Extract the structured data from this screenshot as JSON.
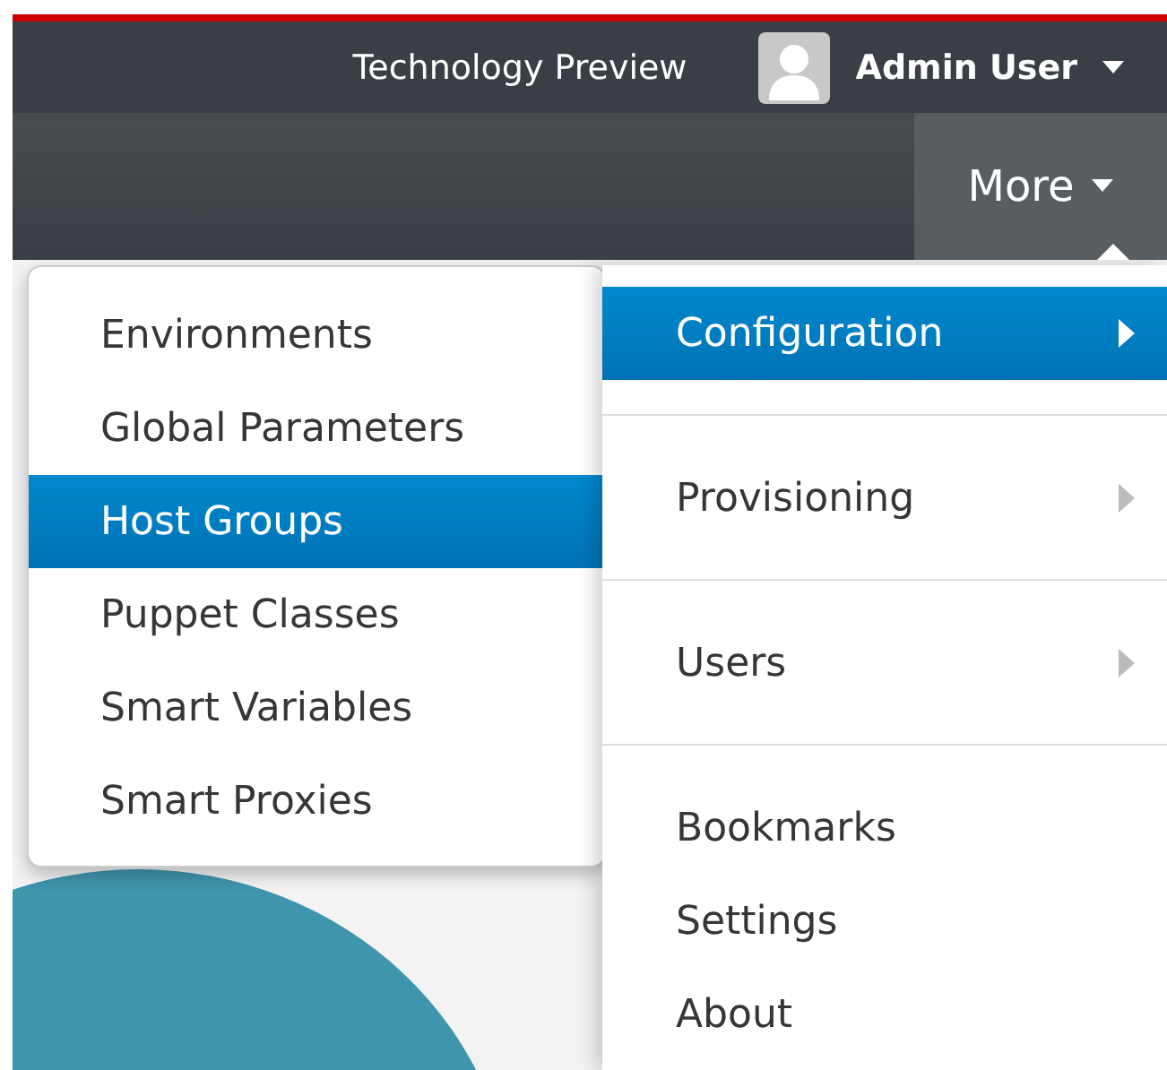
{
  "top_bar": {
    "label": "Technology Preview",
    "user": {
      "name": "Admin User"
    }
  },
  "nav": {
    "more": {
      "label": "More",
      "expanded": true
    }
  },
  "menu": {
    "items": [
      {
        "kind": "submenu",
        "label": "Configuration",
        "selected": true
      },
      {
        "kind": "divider"
      },
      {
        "kind": "submenu",
        "label": "Provisioning",
        "selected": false
      },
      {
        "kind": "divider"
      },
      {
        "kind": "submenu",
        "label": "Users",
        "selected": false
      },
      {
        "kind": "divider"
      },
      {
        "kind": "link",
        "label": "Bookmarks",
        "selected": false
      },
      {
        "kind": "link",
        "label": "Settings",
        "selected": false
      },
      {
        "kind": "link",
        "label": "About",
        "selected": false
      }
    ]
  },
  "submenu": {
    "items": [
      {
        "label": "Environments",
        "selected": false
      },
      {
        "label": "Global Parameters",
        "selected": false
      },
      {
        "label": "Host Groups",
        "selected": true
      },
      {
        "label": "Puppet Classes",
        "selected": false
      },
      {
        "label": "Smart Variables",
        "selected": false
      },
      {
        "label": "Smart Proxies",
        "selected": false
      }
    ]
  }
}
